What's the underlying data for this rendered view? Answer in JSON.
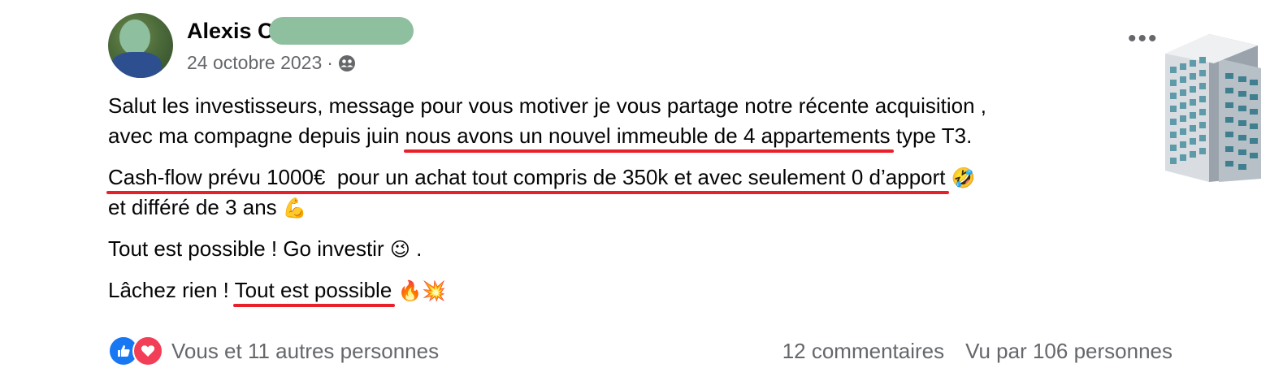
{
  "post": {
    "author_name": "Alexis C",
    "date": "24 octobre 2023",
    "separator": "·",
    "audience_icon": "friends-icon",
    "more_icon": "more-options-icon",
    "more_label": "•••",
    "decoration_icon": "office-building-icon"
  },
  "body": {
    "line1": "Salut les investisseurs, message pour vous motiver je vous partage notre récente acquisition ,",
    "line2_pre": "avec ma compagne depuis juin ",
    "line2_highlight": "nous avons un nouvel immeuble de 4 appartements",
    "line2_post": " type T3.",
    "line3_highlight": "Cash-flow prévu 1000€  pour un achat tout compris de 350k et avec seulement 0 d’apport",
    "line3_emoji": "🤣",
    "line4": "et différé de 3 ans ",
    "line4_emoji": "💪",
    "line5": "Tout est possible ! Go investir ",
    "line5_emoji": "😉",
    "line5_post": " .",
    "line6_pre": "Lâchez rien ! ",
    "line6_highlight": "Tout est possible",
    "line6_emoji": "🔥💥"
  },
  "footer": {
    "reaction_icons": [
      "like-icon",
      "love-icon"
    ],
    "reactions_text": "Vous et 11 autres personnes",
    "comments": "12 commentaires",
    "views": "Vu par 106 personnes"
  },
  "colors": {
    "underline": "#e8202a",
    "secondary_text": "#65676b",
    "like_blue": "#1877f2",
    "love_red": "#f33e58",
    "redaction": "#8ebf9e"
  }
}
